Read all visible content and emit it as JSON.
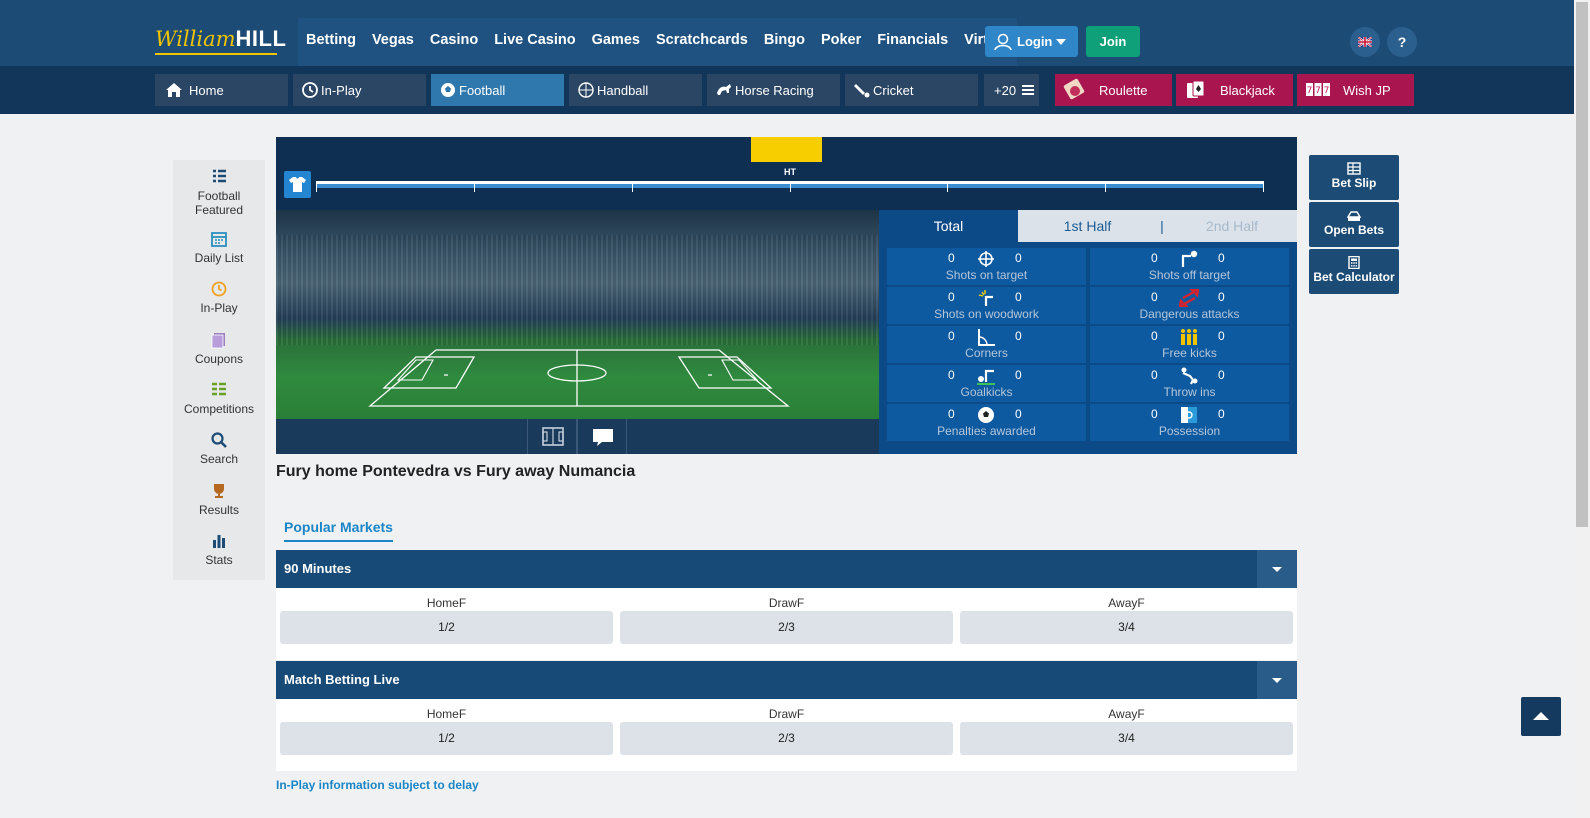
{
  "header": {
    "logo_script": "William",
    "logo_bold": "HILL",
    "nav": [
      "Betting",
      "Vegas",
      "Casino",
      "Live Casino",
      "Games",
      "Scratchcards",
      "Bingo",
      "Poker",
      "Financials",
      "Virtual"
    ],
    "login_label": "Login",
    "join_label": "Join",
    "help_label": "?"
  },
  "sports_nav": {
    "tabs": [
      {
        "label": "Home",
        "icon": "home-icon"
      },
      {
        "label": "In-Play",
        "icon": "clock-icon"
      },
      {
        "label": "Football",
        "icon": "football-icon"
      },
      {
        "label": "Handball",
        "icon": "handball-icon"
      },
      {
        "label": "Horse Racing",
        "icon": "horse-icon"
      },
      {
        "label": "Cricket",
        "icon": "cricket-icon"
      }
    ],
    "more_label": "+20",
    "promos": [
      {
        "label": "Roulette",
        "icon": "roulette-icon"
      },
      {
        "label": "Blackjack",
        "icon": "cards-icon"
      },
      {
        "label": "Wish JP",
        "icon": "slots-icon"
      }
    ]
  },
  "sidebar": {
    "items": [
      {
        "label_line1": "Football",
        "label_line2": "Featured",
        "icon": "list-icon"
      },
      {
        "label": "Daily List",
        "icon": "calendar-icon"
      },
      {
        "label": "In-Play",
        "icon": "clock-icon"
      },
      {
        "label": "Coupons",
        "icon": "coupon-icon"
      },
      {
        "label": "Competitions",
        "icon": "competitions-icon"
      },
      {
        "label": "Search",
        "icon": "search-icon"
      },
      {
        "label": "Results",
        "icon": "trophy-icon"
      },
      {
        "label": "Stats",
        "icon": "bar-chart-icon"
      }
    ]
  },
  "scoreboard": {
    "ht_label": "HT",
    "stat_tabs": {
      "total": "Total",
      "first_half": "1st Half",
      "separator": "|",
      "second_half": "2nd Half"
    },
    "stats": [
      {
        "label": "Shots on target",
        "home": "0",
        "away": "0",
        "icon": "crosshair-icon"
      },
      {
        "label": "Shots off target",
        "home": "0",
        "away": "0",
        "icon": "post-ball-icon"
      },
      {
        "label": "Shots on woodwork",
        "home": "0",
        "away": "0",
        "icon": "woodwork-icon"
      },
      {
        "label": "Dangerous attacks",
        "home": "0",
        "away": "0",
        "icon": "attack-arrows-icon"
      },
      {
        "label": "Corners",
        "home": "0",
        "away": "0",
        "icon": "corner-flag-icon"
      },
      {
        "label": "Free kicks",
        "home": "0",
        "away": "0",
        "icon": "wall-players-icon"
      },
      {
        "label": "Goalkicks",
        "home": "0",
        "away": "0",
        "icon": "goalkick-icon"
      },
      {
        "label": "Throw ins",
        "home": "0",
        "away": "0",
        "icon": "throw-in-icon"
      },
      {
        "label": "Penalties awarded",
        "home": "0",
        "away": "0",
        "icon": "ball-icon"
      },
      {
        "label": "Possession",
        "home": "0",
        "away": "0",
        "icon": "possession-icon"
      }
    ]
  },
  "match": {
    "title": "Fury home Pontevedra vs Fury away Numancia",
    "tab_label": "Popular Markets",
    "markets": [
      {
        "title": "90 Minutes",
        "columns": [
          "HomeF",
          "DrawF",
          "AwayF"
        ],
        "odds": [
          "1/2",
          "2/3",
          "3/4"
        ]
      },
      {
        "title": "Match Betting Live",
        "columns": [
          "HomeF",
          "DrawF",
          "AwayF"
        ],
        "odds": [
          "1/2",
          "2/3",
          "3/4"
        ]
      }
    ],
    "delay_note": "In-Play information subject to delay"
  },
  "right_panel": [
    {
      "label": "Bet Slip",
      "icon": "betslip-icon"
    },
    {
      "label": "Open Bets",
      "icon": "open-bets-icon"
    },
    {
      "label": "Bet Calculator",
      "icon": "calculator-icon"
    }
  ],
  "colors": {
    "header_bg": "#1c4b75",
    "sport_nav_bg": "#12355a",
    "active_tab": "#2f78ad",
    "promo_tab": "#a8154f",
    "join_green": "#0fa07a",
    "link_blue": "#1a86c7",
    "logo_yellow": "#f2c400"
  }
}
